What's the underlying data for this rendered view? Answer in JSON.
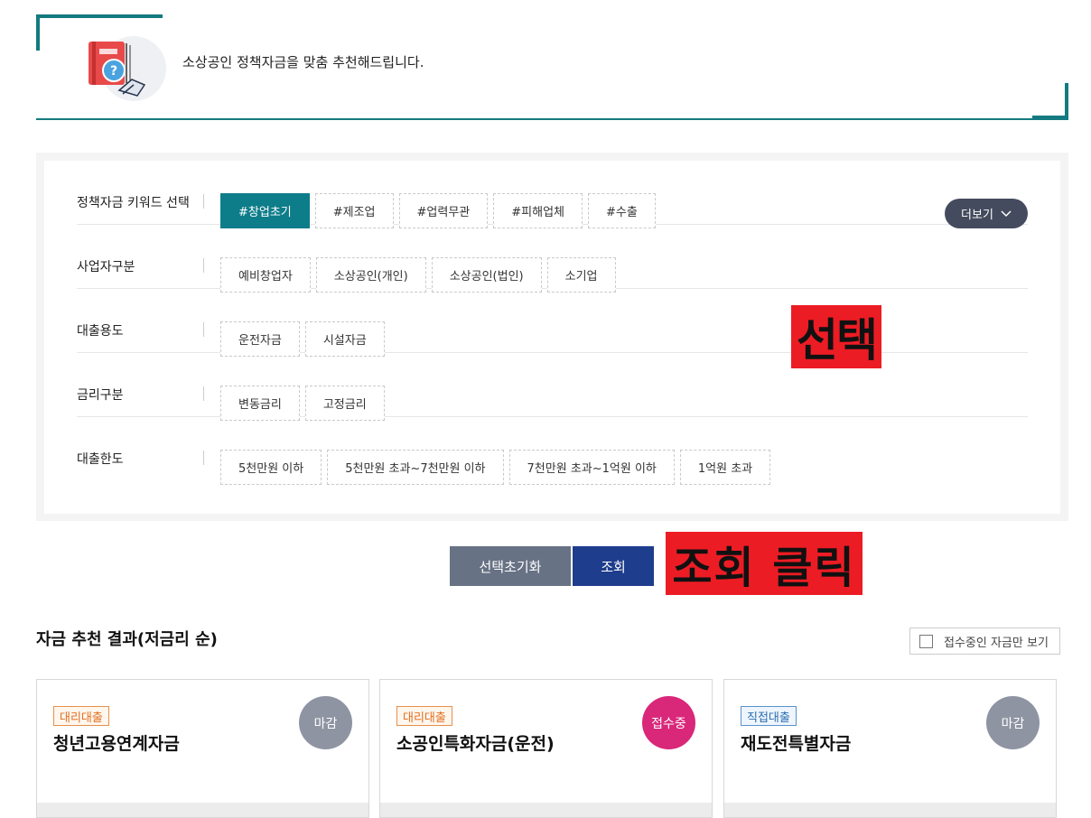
{
  "banner": {
    "text": "소상공인 정책자금을 맞춤 추천해드립니다."
  },
  "filters": {
    "keyword": {
      "label": "정책자금 키워드 선택",
      "chips": [
        "#창업초기",
        "#제조업",
        "#업력무관",
        "#피해업체",
        "#수출"
      ],
      "active": 0,
      "more_label": "더보기"
    },
    "business": {
      "label": "사업자구분",
      "chips": [
        "예비창업자",
        "소상공인(개인)",
        "소상공인(법인)",
        "소기업"
      ]
    },
    "purpose": {
      "label": "대출용도",
      "chips": [
        "운전자금",
        "시설자금"
      ]
    },
    "rate": {
      "label": "금리구분",
      "chips": [
        "변동금리",
        "고정금리"
      ]
    },
    "limit": {
      "label": "대출한도",
      "chips": [
        "5천만원 이하",
        "5천만원 초과~7천만원 이하",
        "7천만원 초과~1억원 이하",
        "1억원 초과"
      ]
    }
  },
  "annotations": {
    "select": "선택",
    "click": "조회 클릭"
  },
  "actions": {
    "reset_label": "선택초기화",
    "search_label": "조회"
  },
  "results": {
    "title": "자금 추천 결과(저금리 순)",
    "only_open_label": "접수중인 자금만 보기",
    "cards": [
      {
        "tag": "대리대출",
        "title": "청년고용연계자금",
        "status": "마감"
      },
      {
        "tag": "대리대출",
        "title": "소공인특화자금(운전)",
        "status": "접수중"
      },
      {
        "tag": "직접대출",
        "title": "재도전특별자금",
        "status": "마감"
      }
    ]
  },
  "colors": {
    "accent": "#0e7d8a",
    "search": "#1e3d8c",
    "reset": "#687285",
    "open": "#d9277a",
    "closed": "#8e94a2",
    "annotation": "#ec1c24"
  }
}
